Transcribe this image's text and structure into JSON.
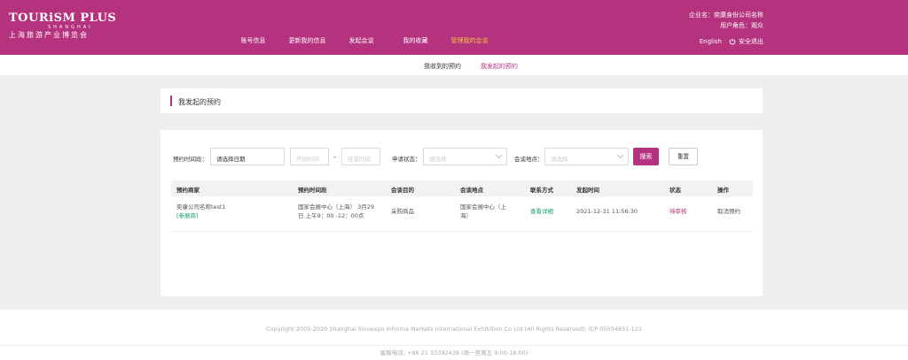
{
  "header": {
    "logo_main": "TOURiSM PLUS",
    "logo_sub": "SHANGHAI",
    "logo_cn": "上海旅游产业博览会",
    "nav": [
      {
        "label": "账号信息"
      },
      {
        "label": "更新我的信息"
      },
      {
        "label": "发起会谈"
      },
      {
        "label": "我的收藏"
      },
      {
        "label": "管理我的会谈"
      }
    ],
    "company_line": "企业名：奕康身份公司名称",
    "role_line": "用户角色：观众",
    "lang_label": "English",
    "logout_label": "安全退出"
  },
  "subnav": {
    "received": "我收到的预约",
    "initiated": "我发起的预约"
  },
  "title": "我发起的预约",
  "filters": {
    "time_label": "预约时间段：",
    "date_value": "请选择日期",
    "start_placeholder": "开始时间",
    "dash": "-",
    "end_placeholder": "结束时间",
    "status_label": "申请状态：",
    "status_placeholder": "请选择",
    "location_label": "会谈地点：",
    "location_placeholder": "请选择",
    "search_label": "搜索",
    "reset_label": "重置"
  },
  "table": {
    "headers": [
      "预约商家",
      "预约时间段",
      "会谈目的",
      "会谈地点",
      "联系方式",
      "发起时间",
      "状态",
      "操作"
    ],
    "rows": [
      {
        "merchant": "奕康公司名称test1",
        "tag": "[参展商]",
        "time_line1": "国家会展中心（上海） 3月29",
        "time_line2": "日 上午9：00 -12：00点",
        "purpose": "采购商品",
        "location_line1": "国家会展中心（上",
        "location_line2": "海）",
        "contact": "查看详细",
        "created": "2021-12-31 11:56:30",
        "status": "待审核",
        "action": "取消预约"
      }
    ]
  },
  "footer": {
    "copyright": "Copyright 2005-2020 Shanghai Sinoexpo Informa Markets International Exhibition Co Ltd (All Rights Reserved). ICP 05034851-121",
    "hotline": "客服电话: +86 21 33392438 (周一至周五 9:00-18:00)"
  },
  "colors": {
    "brand": "#b5327e",
    "active_nav": "#f7c24a",
    "link_green": "#1a9a77"
  }
}
